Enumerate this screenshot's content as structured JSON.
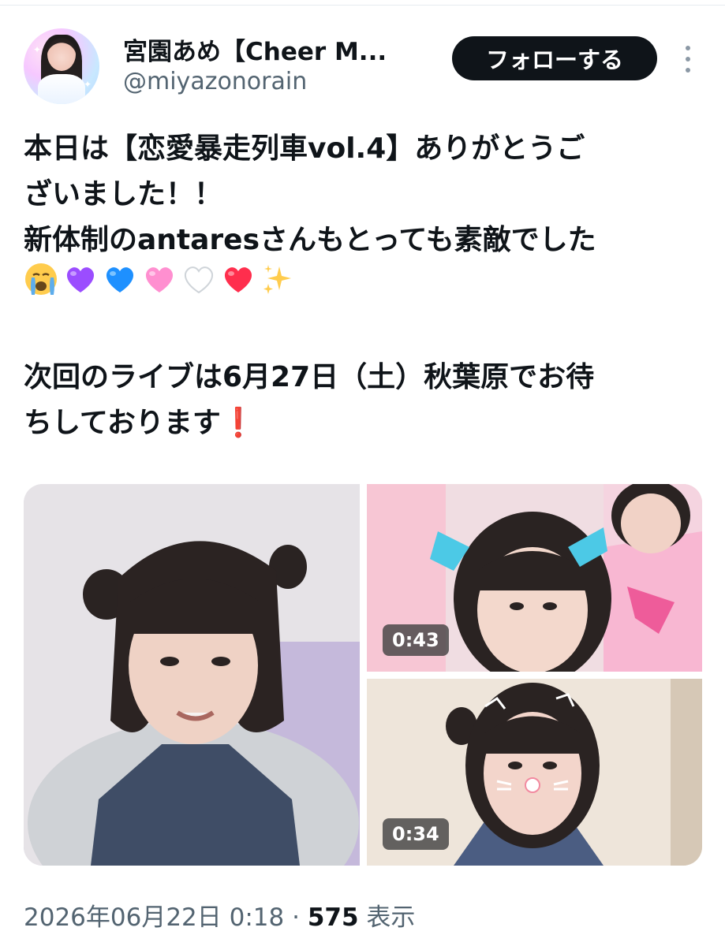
{
  "author": {
    "display_name": "宮園あめ【Cheer M...",
    "handle": "@miyazonorain"
  },
  "header": {
    "follow_label": "フォローする",
    "more_icon": "more-vertical-icon"
  },
  "tweet": {
    "lines": [
      "本日は【恋愛暴走列車vol.4】ありがとうご",
      "ざいました！！",
      "新体制のantaresさんもとっても素敵でした"
    ],
    "emoji": [
      "crying-face",
      "purple-heart",
      "blue-heart",
      "pink-heart",
      "white-heart",
      "red-heart",
      "sparkles"
    ],
    "line_next_1": "次回のライブは6月27日（土）秋葉原でお待",
    "line_next_2": "ちしております",
    "exclamation": "❗"
  },
  "media": {
    "videos": [
      {
        "duration": "0:43"
      },
      {
        "duration": "0:34"
      }
    ]
  },
  "meta": {
    "timestamp": "2026年06月22日 0:18",
    "separator": " · ",
    "view_count": "575",
    "view_label": " 表示"
  },
  "colors": {
    "text": "#0f1419",
    "secondary": "#536471",
    "follow_bg": "#0f1419",
    "purple_heart": "#9b4dff",
    "blue_heart": "#1e90ff",
    "pink_heart": "#ff8fd0",
    "red_heart": "#ff2e4d"
  }
}
